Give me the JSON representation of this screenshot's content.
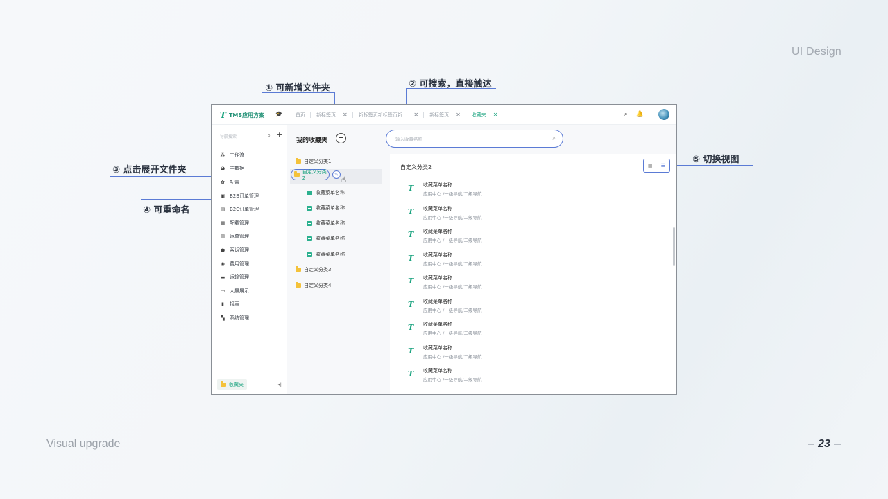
{
  "slide": {
    "title": "UI Design",
    "footer": "Visual upgrade",
    "page": "23"
  },
  "annotations": {
    "a1": "① 可新增文件夹",
    "a2": "② 可搜索，直接触达",
    "a3": "③ 点击展开文件夹",
    "a4": "④ 可重命名",
    "a5": "⑤ 切换视图"
  },
  "app": {
    "logo": "TMS应用方案",
    "tabs": [
      {
        "label": "首页",
        "closable": false
      },
      {
        "label": "新标签页",
        "closable": true
      },
      {
        "label": "新标签页新标签页新...",
        "closable": true
      },
      {
        "label": "新标签页",
        "closable": true
      },
      {
        "label": "收藏夹",
        "closable": true,
        "active": true
      }
    ],
    "nav": {
      "search_placeholder": "导航搜索",
      "items": [
        {
          "icon": "workflow-icon",
          "label": "工作流"
        },
        {
          "icon": "pie-chart-icon",
          "label": "主数据"
        },
        {
          "icon": "gear-icon",
          "label": "配置"
        },
        {
          "icon": "order-icon",
          "label": "B2B订单管理"
        },
        {
          "icon": "order-icon",
          "label": "B2C订单管理"
        },
        {
          "icon": "cargo-icon",
          "label": "配载管理"
        },
        {
          "icon": "waybill-icon",
          "label": "运单管理"
        },
        {
          "icon": "complaint-icon",
          "label": "客诉管理"
        },
        {
          "icon": "cost-icon",
          "label": "费用管理"
        },
        {
          "icon": "truck-icon",
          "label": "运输管理"
        },
        {
          "icon": "screen-icon",
          "label": "大屏展示"
        },
        {
          "icon": "report-icon",
          "label": "报表"
        },
        {
          "icon": "grid-icon",
          "label": "系统管理"
        }
      ],
      "footer_label": "收藏夹"
    },
    "folders": {
      "title": "我的收藏夹",
      "items": [
        {
          "label": "自定义分类1"
        },
        {
          "label": "自定义分类2",
          "selected": true
        },
        {
          "label": "自定义分类3"
        },
        {
          "label": "自定义分类4"
        }
      ],
      "sub_items": [
        "收藏菜单名称",
        "收藏菜单名称",
        "收藏菜单名称",
        "收藏菜单名称",
        "收藏菜单名称"
      ]
    },
    "search_placeholder": "输入收藏名称",
    "content_title": "自定义分类2",
    "favorites": [
      {
        "name": "收藏菜单名称",
        "path": "应用中心 /一级导航/二级导航"
      },
      {
        "name": "收藏菜单名称",
        "path": "应用中心 /一级导航/二级导航"
      },
      {
        "name": "收藏菜单名称",
        "path": "应用中心 /一级导航/二级导航"
      },
      {
        "name": "收藏菜单名称",
        "path": "应用中心 /一级导航/二级导航"
      },
      {
        "name": "收藏菜单名称",
        "path": "应用中心 /一级导航/二级导航"
      },
      {
        "name": "收藏菜单名称",
        "path": "应用中心 /一级导航/二级导航"
      },
      {
        "name": "收藏菜单名称",
        "path": "应用中心 /一级导航/二级导航"
      },
      {
        "name": "收藏菜单名称",
        "path": "应用中心 /一级导航/二级导航"
      },
      {
        "name": "收藏菜单名称",
        "path": "应用中心 /一级导航/二级导航"
      }
    ],
    "colors": {
      "accent": "#1aa37f",
      "annotation": "#5b7bd5",
      "folder": "#f4c23a"
    }
  }
}
